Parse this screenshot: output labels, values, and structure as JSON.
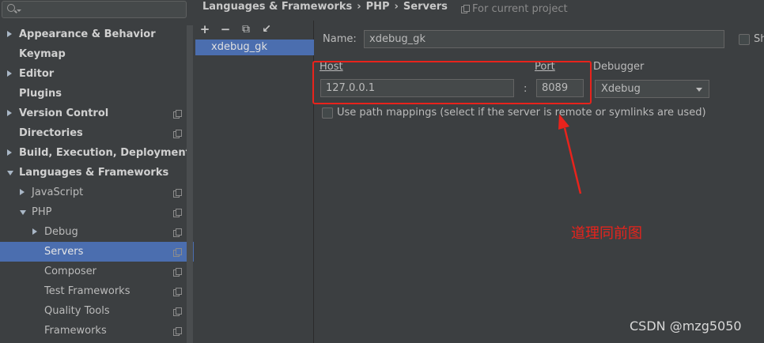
{
  "search": {
    "placeholder": ""
  },
  "tree": {
    "items": [
      {
        "label": "Appearance & Behavior"
      },
      {
        "label": "Keymap"
      },
      {
        "label": "Editor"
      },
      {
        "label": "Plugins"
      },
      {
        "label": "Version Control"
      },
      {
        "label": "Directories"
      },
      {
        "label": "Build, Execution, Deployment"
      },
      {
        "label": "Languages & Frameworks"
      },
      {
        "label": "JavaScript"
      },
      {
        "label": "PHP"
      },
      {
        "label": "Debug"
      },
      {
        "label": "Servers"
      },
      {
        "label": "Composer"
      },
      {
        "label": "Test Frameworks"
      },
      {
        "label": "Quality Tools"
      },
      {
        "label": "Frameworks"
      }
    ]
  },
  "header": {
    "breadcrumb": [
      "Languages & Frameworks",
      "PHP",
      "Servers"
    ],
    "separator": "›",
    "scope_note": "For current project"
  },
  "servers": {
    "toolbar": {
      "add": "+",
      "remove": "−",
      "copy": "⧉",
      "import": "↙"
    },
    "list": [
      "xdebug_gk"
    ]
  },
  "form": {
    "name_label": "Name:",
    "name_value": "xdebug_gk",
    "shared_label": "Sh",
    "host_label": "Host",
    "host_value": "127.0.0.1",
    "colon": ":",
    "port_label": "Port",
    "port_value": "8089",
    "debugger_label": "Debugger",
    "debugger_value": "Xdebug",
    "path_mappings_label": "Use path mappings (select if the server is remote or symlinks are used)"
  },
  "annotation": {
    "text": "道理同前图",
    "color": "#e8231c"
  },
  "watermark": "CSDN @mzg5050",
  "colors": {
    "background": "#3c3f41",
    "selection": "#4b6eaf",
    "input": "#45494a"
  }
}
